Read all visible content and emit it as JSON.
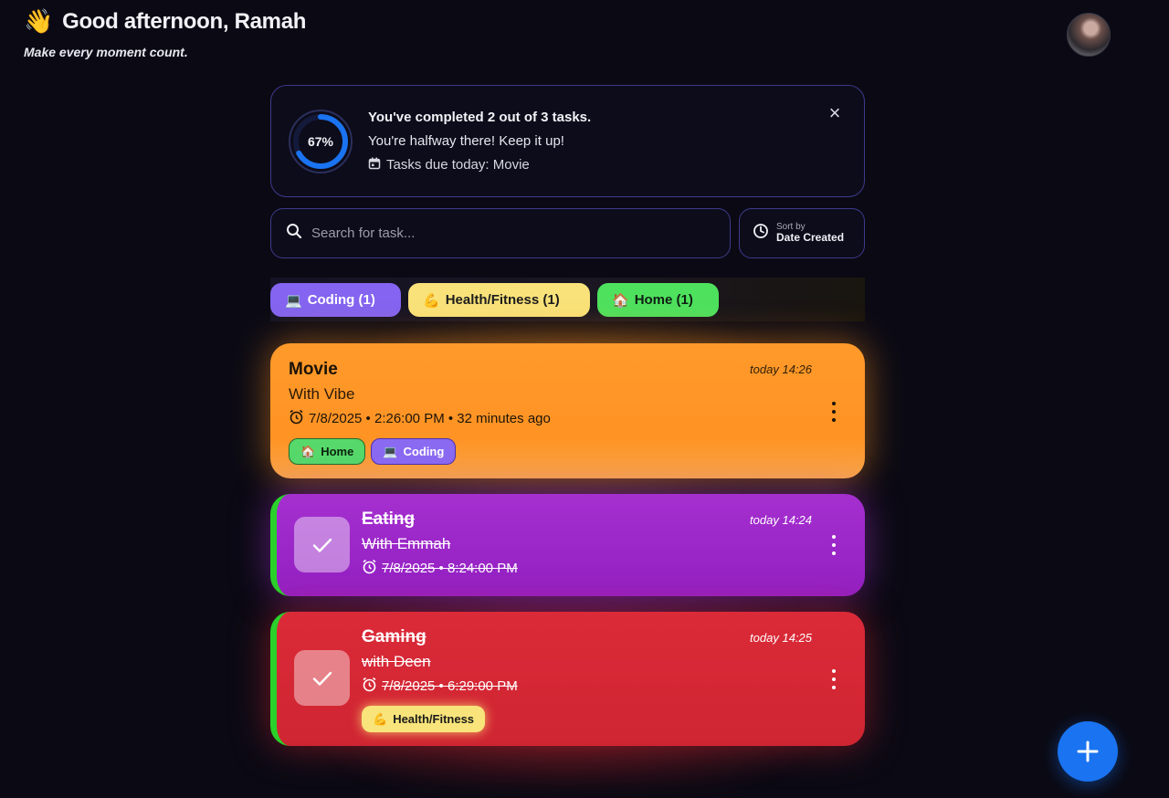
{
  "header": {
    "wave_emoji": "👋",
    "greeting": "Good afternoon, Ramah",
    "tagline": "Make every moment count."
  },
  "progress": {
    "percent_label": "67%",
    "completed_fraction": 0.67,
    "title": "You've completed 2 out of 3 tasks.",
    "subtitle": "You're halfway there! Keep it up!",
    "due_today": "Tasks due today: Movie",
    "ring_color": "#1a73f0",
    "close_glyph": "×"
  },
  "search": {
    "placeholder": "Search for task..."
  },
  "sort": {
    "label": "Sort by",
    "value": "Date Created"
  },
  "categories": [
    {
      "emoji": "💻",
      "label": "Coding (1)",
      "color": "#8464f0"
    },
    {
      "emoji": "💪",
      "label": "Health/Fitness (1)",
      "color": "#f9e27a"
    },
    {
      "emoji": "🏠",
      "label": "Home (1)",
      "color": "#4ee15e"
    }
  ],
  "tasks": [
    {
      "title": "Movie",
      "description": "With Vibe",
      "date": "7/8/2025 • 2:26:00 PM • 32 minutes ago",
      "created": "today 14:26",
      "color": "#ff9a2a",
      "done": false,
      "tags": [
        {
          "emoji": "🏠",
          "label": "Home"
        },
        {
          "emoji": "💻",
          "label": "Coding"
        }
      ]
    },
    {
      "title": "Eating",
      "description": "With Emmah",
      "date": "7/8/2025 • 8:24:00 PM",
      "created": "today 14:24",
      "color": "#a52fcf",
      "done": true,
      "tags": []
    },
    {
      "title": "Gaming",
      "description": "with Deen",
      "date": "7/8/2025 • 6:29:00 PM",
      "created": "today 14:25",
      "color": "#db2a38",
      "done": true,
      "tags": [
        {
          "emoji": "💪",
          "label": "Health/Fitness"
        }
      ]
    }
  ],
  "icons": {
    "search": "search-icon",
    "sort": "clock-icon",
    "calendar": "calendar-icon",
    "alarm": "alarm-icon",
    "menu": "more-vertical-icon",
    "check": "check-icon",
    "add": "plus-icon",
    "close": "close-icon"
  },
  "accent_color": "#1a73f0"
}
